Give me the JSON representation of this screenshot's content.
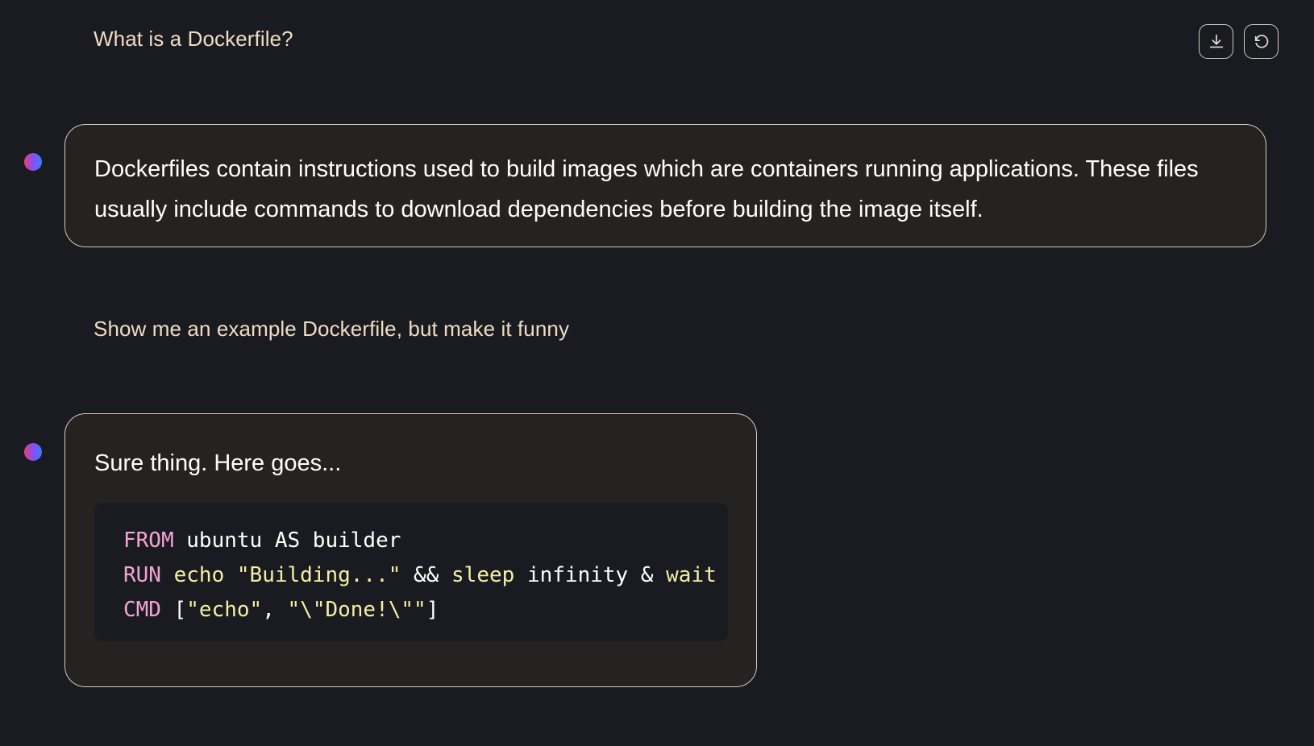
{
  "toolbar": {
    "download_icon": "download-icon",
    "reset_icon": "rotate-ccw-icon"
  },
  "conversation": {
    "user_message_1": "What is a Dockerfile?",
    "assistant_message_1": "Dockerfiles contain instructions used to build images which are containers running applications. These files usually include commands to download dependencies before building the image itself.",
    "user_message_2": "Show me an example Dockerfile, but make it funny",
    "assistant_message_2_intro": "Sure thing. Here goes...",
    "code": {
      "line1": {
        "kw": "FROM",
        "rest": " ubuntu AS builder"
      },
      "line2": {
        "kw": "RUN",
        "cmd1": " echo ",
        "str1": "\"Building...\"",
        "op1": " && ",
        "cmd2": "sleep",
        "rest": " infinity & ",
        "cmd3": "wait"
      },
      "line3": {
        "kw": "CMD",
        "rest1": " [",
        "str1": "\"echo\"",
        "rest2": ", ",
        "str2": "\"\\\"Done!\\\"\"",
        "rest3": "]"
      }
    }
  },
  "colors": {
    "background": "#1a1b20",
    "bubble": "#242321",
    "user_text": "#efdcc3",
    "keyword": "#f4a3d6",
    "command": "#f6eea6"
  }
}
